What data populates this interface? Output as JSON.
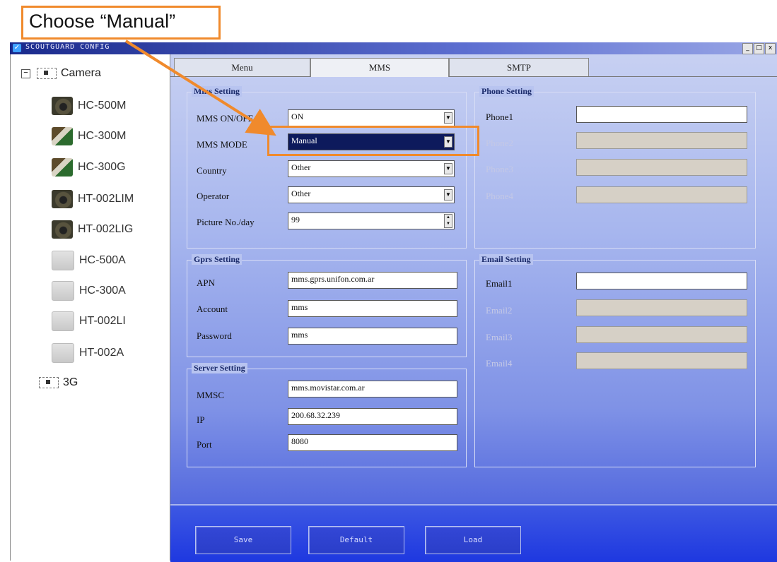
{
  "annotation": {
    "callout_text": "Choose “Manual”",
    "highlight_color": "#f08a2c"
  },
  "window": {
    "title": "SCOUTGUARD CONFIG",
    "controls": [
      "_",
      "□",
      "x"
    ]
  },
  "tree": {
    "root_label": "Camera",
    "toggle": "−",
    "items": [
      {
        "label": "HC-500M",
        "icon": "camera-dark-icon"
      },
      {
        "label": "HC-300M",
        "icon": "camera-camo-icon"
      },
      {
        "label": "HC-300G",
        "icon": "camera-camo-icon"
      },
      {
        "label": "HT-002LIM",
        "icon": "camera-dark-icon"
      },
      {
        "label": "HT-002LIG",
        "icon": "camera-dark-icon"
      },
      {
        "label": "HC-500A",
        "icon": "camera-grey-icon"
      },
      {
        "label": "HC-300A",
        "icon": "camera-grey-icon"
      },
      {
        "label": "HT-002LI",
        "icon": "camera-grey-icon"
      },
      {
        "label": "HT-002A",
        "icon": "camera-grey-icon"
      }
    ],
    "folder_3g_label": "3G"
  },
  "tabs": [
    {
      "label": "Menu",
      "active": false
    },
    {
      "label": "MMS",
      "active": true
    },
    {
      "label": "SMTP",
      "active": false
    }
  ],
  "mms_setting": {
    "title": "Mms Setting",
    "onoff_label": "MMS ON/OFF",
    "onoff_value": "ON",
    "mode_label": "MMS MODE",
    "mode_value": "Manual",
    "country_label": "Country",
    "country_value": "Other",
    "operator_label": "Operator",
    "operator_value": "Other",
    "picture_label": "Picture No./day",
    "picture_value": "99"
  },
  "gprs_setting": {
    "title": "Gprs Setting",
    "apn_label": "APN",
    "apn_value": "mms.gprs.unifon.com.ar",
    "account_label": "Account",
    "account_value": "mms",
    "password_label": "Password",
    "password_value": "mms"
  },
  "server_setting": {
    "title": "Server Setting",
    "mmsc_label": "MMSC",
    "mmsc_value": "mms.movistar.com.ar",
    "ip_label": "IP",
    "ip_value": "200.68.32.239",
    "port_label": "Port",
    "port_value": "8080"
  },
  "phone_setting": {
    "title": "Phone Setting",
    "phone1_label": "Phone1",
    "phone1_value": "",
    "phone2_label": "Phone2",
    "phone3_label": "Phone3",
    "phone4_label": "Phone4"
  },
  "email_setting": {
    "title": "Email Setting",
    "email1_label": "Email1",
    "email1_value": "",
    "email2_label": "Email2",
    "email3_label": "Email3",
    "email4_label": "Email4"
  },
  "buttons": {
    "save": "Save",
    "default": "Default",
    "load": "Load"
  }
}
